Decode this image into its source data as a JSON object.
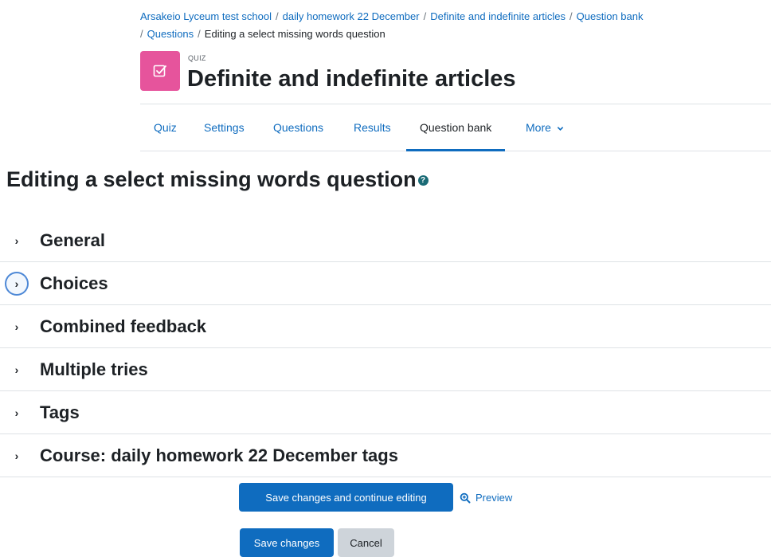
{
  "breadcrumb": {
    "items": [
      "Arsakeio Lyceum test school",
      "daily homework 22 December",
      "Definite and indefinite articles",
      "Question bank",
      "Questions",
      "Editing a select missing words question"
    ],
    "separator": "/"
  },
  "header": {
    "kicker": "QUIZ",
    "title": "Definite and indefinite articles",
    "icon": "quiz-checkbox-icon",
    "icon_color": "#e6549c"
  },
  "tabs": [
    {
      "label": "Quiz"
    },
    {
      "label": "Settings"
    },
    {
      "label": "Questions"
    },
    {
      "label": "Results"
    },
    {
      "label": "Question bank",
      "active": true
    },
    {
      "label": "More"
    }
  ],
  "main": {
    "heading": "Editing a select missing words question",
    "help_icon": "question-circle-icon"
  },
  "sections": [
    {
      "label": "General"
    },
    {
      "label": "Choices",
      "focused": true
    },
    {
      "label": "Combined feedback"
    },
    {
      "label": "Multiple tries"
    },
    {
      "label": "Tags"
    },
    {
      "label": "Course: daily homework 22 December tags"
    }
  ],
  "actions": {
    "save_continue": "Save changes and continue editing",
    "preview": "Preview",
    "save": "Save changes",
    "cancel": "Cancel"
  },
  "colors": {
    "primary": "#0f6cbf",
    "link": "#0f6cbf",
    "quiz_icon": "#e6549c",
    "border": "#dee2e6"
  }
}
